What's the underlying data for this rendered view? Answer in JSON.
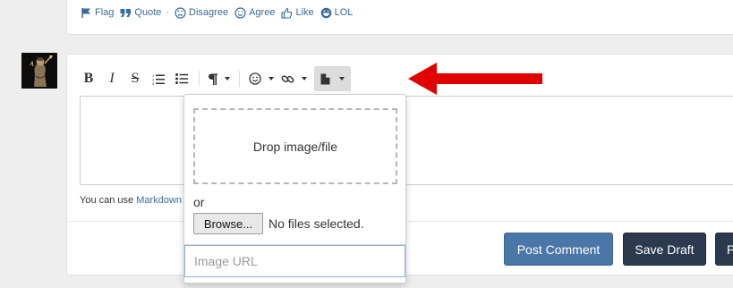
{
  "reactions": [
    {
      "label": "Flag",
      "icon": "flag-icon"
    },
    {
      "label": "Quote",
      "icon": "quote-icon"
    },
    {
      "label": "Disagree",
      "icon": "disagree-icon"
    },
    {
      "label": "Agree",
      "icon": "agree-icon"
    },
    {
      "label": "Like",
      "icon": "like-icon"
    },
    {
      "label": "LOL",
      "icon": "lol-icon"
    }
  ],
  "reaction_separator": "·",
  "toolbar": {
    "bold": "B",
    "italic": "I",
    "strike": "S",
    "items": [
      "bold",
      "italic",
      "strikethrough",
      "ordered-list",
      "unordered-list",
      "paragraph-dropdown",
      "emoji-dropdown",
      "link-dropdown",
      "file-dropdown"
    ]
  },
  "editor": {
    "helper_prefix": "You can use ",
    "helper_link": "Markdown"
  },
  "upload": {
    "dropzone_label": "Drop image/file",
    "or_label": "or",
    "browse_label": "Browse...",
    "files_status": "No files selected.",
    "url_placeholder": "Image URL"
  },
  "buttons": {
    "post": "Post Comment",
    "draft": "Save Draft",
    "preview": "P"
  },
  "colors": {
    "link": "#3a6a9b",
    "post_button": "#4a76a8",
    "dark_button": "#2b3a4f",
    "annotation_arrow": "#e00000"
  }
}
